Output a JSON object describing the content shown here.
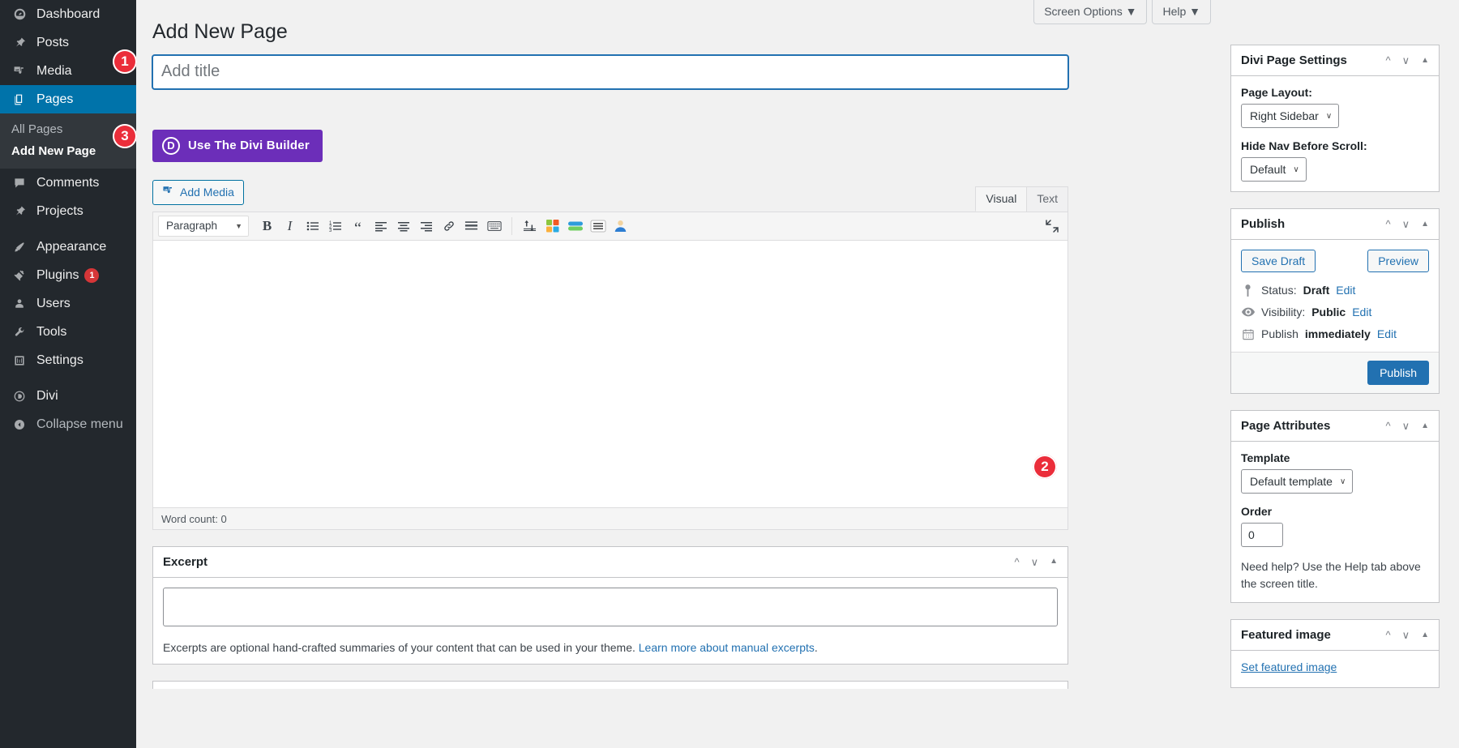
{
  "sidebar": {
    "items": [
      {
        "label": "Dashboard",
        "icon": "dashboard-icon",
        "current": false
      },
      {
        "label": "Posts",
        "icon": "pin-icon",
        "current": false
      },
      {
        "label": "Media",
        "icon": "media-icon",
        "current": false
      },
      {
        "label": "Pages",
        "icon": "pages-icon",
        "current": true
      },
      {
        "label": "Comments",
        "icon": "comments-icon",
        "current": false
      },
      {
        "label": "Projects",
        "icon": "pin-icon",
        "current": false
      },
      {
        "label": "Appearance",
        "icon": "brush-icon",
        "current": false
      },
      {
        "label": "Plugins",
        "icon": "plug-icon",
        "current": false,
        "badge": "1"
      },
      {
        "label": "Users",
        "icon": "user-icon",
        "current": false
      },
      {
        "label": "Tools",
        "icon": "wrench-icon",
        "current": false
      },
      {
        "label": "Settings",
        "icon": "settings-icon",
        "current": false
      },
      {
        "label": "Divi",
        "icon": "divi-icon",
        "current": false
      },
      {
        "label": "Collapse menu",
        "icon": "collapse-icon",
        "current": false
      }
    ],
    "submenu": [
      {
        "label": "All Pages",
        "active": false
      },
      {
        "label": "Add New Page",
        "active": true
      }
    ]
  },
  "header": {
    "screen_options": "Screen Options ▼",
    "help": "Help ▼",
    "page_title": "Add New Page"
  },
  "title_field": {
    "value": "",
    "placeholder": "Add title"
  },
  "divi_builder": {
    "label": "Use The Divi Builder",
    "glyph": "D",
    "color": "#6c2eb9"
  },
  "editor": {
    "add_media": "Add Media",
    "tabs": [
      {
        "label": "Visual",
        "active": true
      },
      {
        "label": "Text",
        "active": false
      }
    ],
    "format_select": "Paragraph",
    "word_count": "Word count: 0",
    "toolbar_buttons": [
      "bold-icon",
      "italic-icon",
      "bulleted-list-icon",
      "numbered-list-icon",
      "blockquote-icon",
      "align-left-icon",
      "align-center-icon",
      "align-right-icon",
      "link-icon",
      "read-more-icon",
      "keyboard-shortcuts-icon",
      "sort-icon",
      "color-blocks-icon",
      "layers-icon",
      "lines-icon",
      "avatar-icon",
      "fullscreen-icon"
    ]
  },
  "excerpt": {
    "title": "Excerpt",
    "value": "",
    "help_prefix": "Excerpts are optional hand-crafted summaries of your content that can be used in your theme. ",
    "help_link": "Learn more about manual excerpts",
    "help_suffix": "."
  },
  "divi_page_settings": {
    "title": "Divi Page Settings",
    "page_layout_label": "Page Layout:",
    "page_layout_value": "Right Sidebar",
    "hide_nav_label": "Hide Nav Before Scroll:",
    "hide_nav_value": "Default"
  },
  "publish": {
    "title": "Publish",
    "save_draft": "Save Draft",
    "preview": "Preview",
    "status_label": "Status:",
    "status_value": "Draft",
    "visibility_label": "Visibility:",
    "visibility_value": "Public",
    "publish_label": "Publish",
    "publish_value": "immediately",
    "edit": "Edit",
    "publish_button": "Publish"
  },
  "page_attributes": {
    "title": "Page Attributes",
    "template_label": "Template",
    "template_value": "Default template",
    "order_label": "Order",
    "order_value": "0",
    "help": "Need help? Use the Help tab above the screen title."
  },
  "featured_image": {
    "title": "Featured image",
    "link": "Set featured image"
  },
  "steps": [
    {
      "number": "1",
      "target": "title-input"
    },
    {
      "number": "2",
      "target": "template-select"
    },
    {
      "number": "3",
      "target": "divi-builder-button"
    }
  ],
  "colors": {
    "accent": "#2271b1",
    "sidebar_bg": "#23282d",
    "current_menu": "#0073aa",
    "divi_purple": "#6c2eb9",
    "step_red": "#eb2d3a"
  }
}
